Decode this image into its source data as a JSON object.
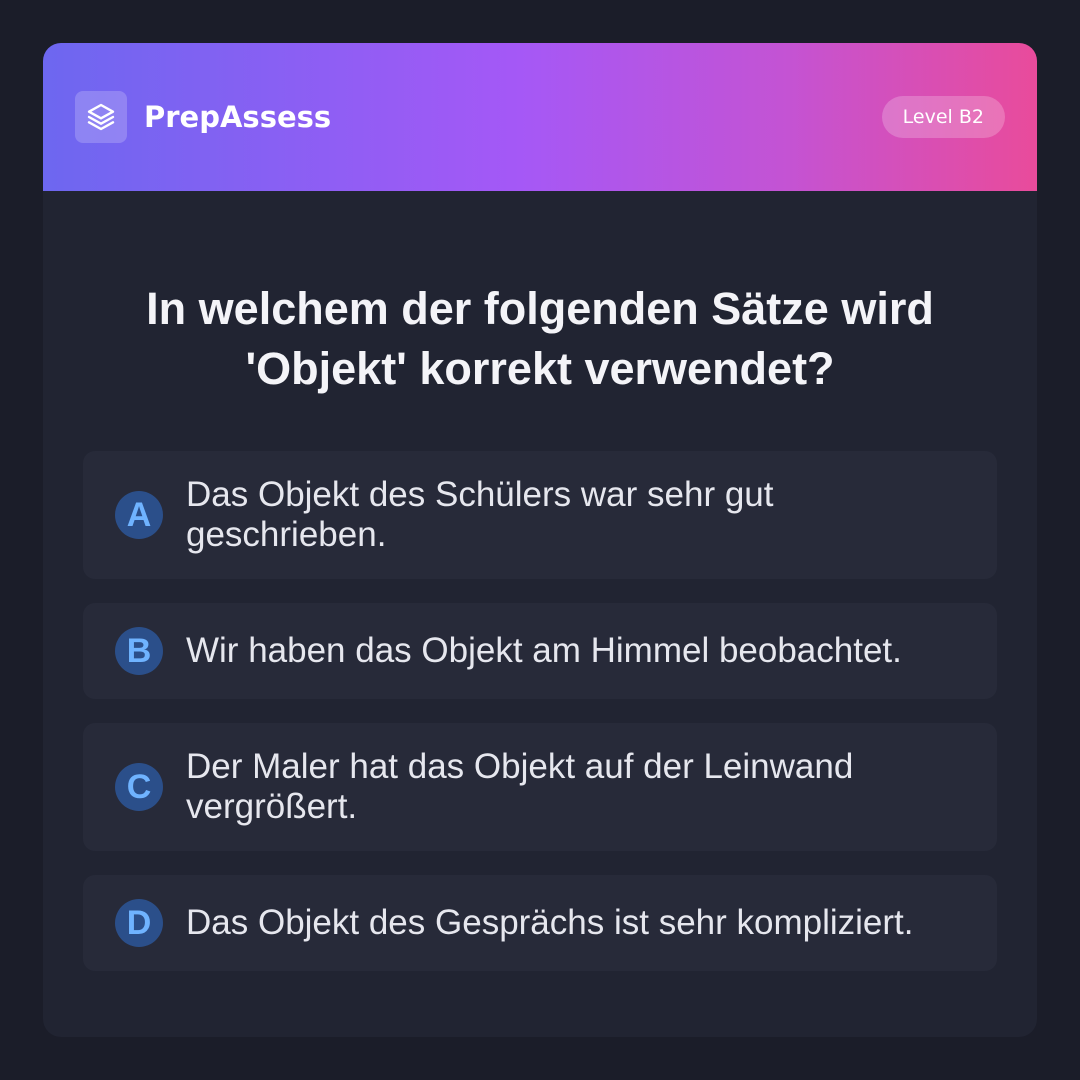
{
  "header": {
    "app_name": "PrepAssess",
    "logo_icon": "layers-icon",
    "level_badge": "Level B2",
    "gradient": [
      "#6d67f0",
      "#a558f6",
      "#e94b9b"
    ]
  },
  "question": {
    "text": "In welchem der folgenden Sätze wird 'Objekt' korrekt verwendet?"
  },
  "options": [
    {
      "letter": "A",
      "text": "Das Objekt des Schülers war sehr gut geschrieben."
    },
    {
      "letter": "B",
      "text": "Wir haben das Objekt am Himmel beobachtet."
    },
    {
      "letter": "C",
      "text": "Der Maler hat das Objekt auf der Leinwand vergrößert."
    },
    {
      "letter": "D",
      "text": "Das Objekt des Gesprächs ist sehr kompliziert."
    }
  ],
  "colors": {
    "background": "#1b1d29",
    "card": "#212432",
    "option_bg": "#272a39",
    "letter_bg": "#2b4f8a",
    "letter_fg": "#6fb3ff"
  }
}
